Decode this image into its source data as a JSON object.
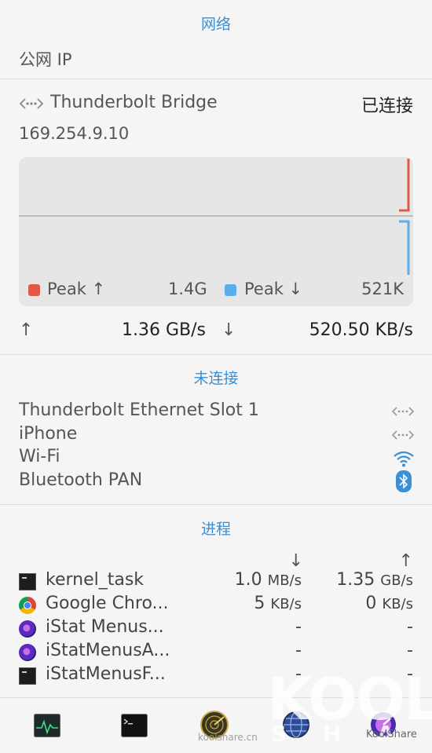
{
  "header": {
    "title": "网络",
    "public_ip_label": "公网 IP"
  },
  "interface": {
    "name": "Thunderbolt Bridge",
    "status": "已连接",
    "ip": "169.254.9.10"
  },
  "graph": {
    "legend": [
      {
        "label": "Peak ↑",
        "value": "1.4G",
        "color": "#e05a47"
      },
      {
        "label": "Peak ↓",
        "value": "521K",
        "color": "#5aaeea"
      }
    ]
  },
  "throughput": {
    "up_arrow": "↑",
    "up_value": "1.36 GB/s",
    "down_arrow": "↓",
    "down_value": "520.50 KB/s"
  },
  "disconnected": {
    "title": "未连接",
    "items": [
      {
        "label": "Thunderbolt Ethernet Slot 1",
        "icon": "ethernet-arrows-icon"
      },
      {
        "label": "iPhone",
        "icon": "ethernet-arrows-icon"
      },
      {
        "label": "Wi-Fi",
        "icon": "wifi-icon"
      },
      {
        "label": "Bluetooth PAN",
        "icon": "bluetooth-icon"
      }
    ]
  },
  "processes": {
    "title": "进程",
    "col_down": "↓",
    "col_up": "↑",
    "rows": [
      {
        "name": "kernel_task",
        "icon": "terminal-icon",
        "down": "1.0",
        "down_unit": "MB/s",
        "up": "1.35",
        "up_unit": "GB/s"
      },
      {
        "name": "Google Chro...",
        "icon": "chrome-icon",
        "down": "5",
        "down_unit": "KB/s",
        "up": "0",
        "up_unit": "KB/s"
      },
      {
        "name": "iStat Menus...",
        "icon": "istat-icon",
        "down": "-",
        "down_unit": "",
        "up": "-",
        "up_unit": ""
      },
      {
        "name": "iStatMenusA...",
        "icon": "istat-icon",
        "down": "-",
        "down_unit": "",
        "up": "-",
        "up_unit": ""
      },
      {
        "name": "iStatMenusF...",
        "icon": "terminal-icon",
        "down": "-",
        "down_unit": "",
        "up": "-",
        "up_unit": ""
      }
    ]
  },
  "dock": {
    "icons": [
      "activity-monitor-icon",
      "terminal-icon",
      "network-radar-icon",
      "network-globe-icon",
      "istat-menus-icon"
    ]
  },
  "watermark": {
    "big": "KOOL",
    "letters": "S H A",
    "site": "koolshare.cn",
    "brand": "KoolShare"
  }
}
